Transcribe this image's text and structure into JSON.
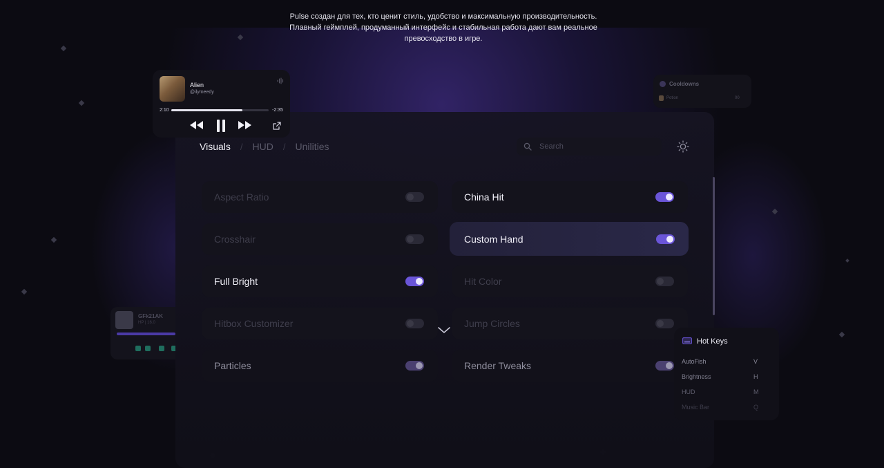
{
  "tagline": {
    "line1": "Pulse создан для тех, кто ценит стиль, удобство и максимальную производительность.",
    "line2": "Плавный геймплей, продуманный интерфейс и стабильная работа дают вам реальное",
    "line3": "превосходство в игре."
  },
  "music": {
    "title": "Alien",
    "artist": "@ilymeedy",
    "elapsed": "2:10",
    "remaining": "-2:35",
    "progress": 0.73,
    "icons": [
      "rewind-icon",
      "pause-icon",
      "fast-forward-icon",
      "open-external-icon",
      "waveform-icon"
    ]
  },
  "cooldowns": {
    "title": "Cooldowns",
    "item_name": "Potion",
    "item_time": "00"
  },
  "target_hud": {
    "name": "GFk21AK",
    "stats": "HP  |  16.0"
  },
  "tabs": [
    {
      "label": "Visuals",
      "active": true
    },
    {
      "label": "HUD",
      "active": false
    },
    {
      "label": "Unilities",
      "active": false
    }
  ],
  "search": {
    "placeholder": "Search"
  },
  "modules_left": [
    {
      "label": "Aspect Ratio",
      "enabled": false
    },
    {
      "label": "Crosshair",
      "enabled": false
    },
    {
      "label": "Full Bright",
      "enabled": true
    },
    {
      "label": "Hitbox Customizer",
      "enabled": false
    },
    {
      "label": "Particles",
      "enabled": true
    }
  ],
  "modules_right": [
    {
      "label": "China Hit",
      "enabled": true
    },
    {
      "label": "Custom Hand",
      "enabled": true
    },
    {
      "label": "Hit Color",
      "enabled": false
    },
    {
      "label": "Jump Circles",
      "enabled": false
    },
    {
      "label": "Render Tweaks",
      "enabled": true
    }
  ],
  "hotkeys": {
    "title": "Hot Keys",
    "items": [
      {
        "name": "AutoFish",
        "key": "V"
      },
      {
        "name": "Brightness",
        "key": "H"
      },
      {
        "name": "HUD",
        "key": "M"
      },
      {
        "name": "Music Bar",
        "key": "Q"
      }
    ]
  },
  "colors": {
    "accent": "#6a55d8",
    "background": "#0c0b12",
    "panel": "#14131c"
  }
}
